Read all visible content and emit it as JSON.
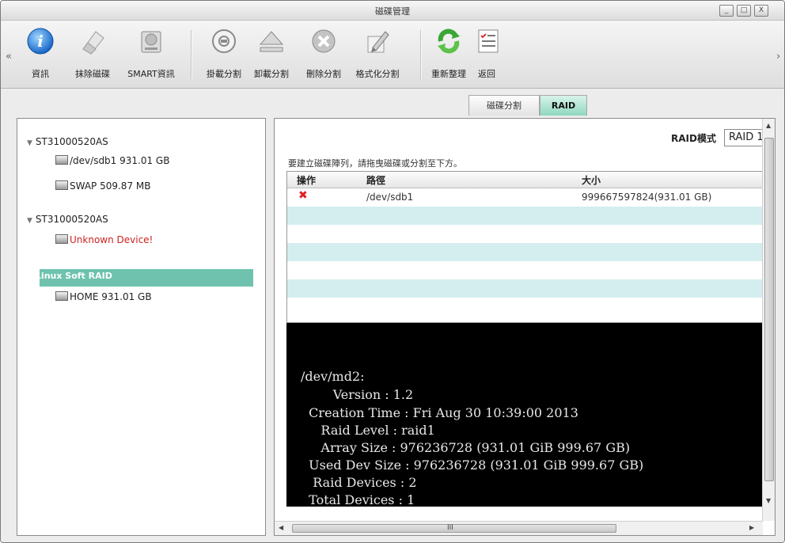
{
  "window": {
    "title": "磁碟管理",
    "controls": [
      "_",
      "□",
      "X"
    ]
  },
  "toolbar": {
    "left_arrow": "«",
    "right_arrow": "›",
    "buttons": [
      {
        "label": "資訊",
        "icon": "info-icon"
      },
      {
        "label": "抹除磁碟",
        "icon": "eraser-icon"
      },
      {
        "label": "SMART資訊",
        "icon": "smart-disk-icon"
      },
      {
        "label": "掛載分割",
        "icon": "mount-icon"
      },
      {
        "label": "卸載分割",
        "icon": "eject-icon"
      },
      {
        "label": "刪除分割",
        "icon": "delete-icon"
      },
      {
        "label": "格式化分割",
        "icon": "format-pencil-icon"
      },
      {
        "label": "重新整理",
        "icon": "refresh-icon"
      },
      {
        "label": "返回",
        "icon": "checklist-icon"
      }
    ]
  },
  "tabs": [
    {
      "label": "磁碟分割",
      "active": false
    },
    {
      "label": "RAID",
      "active": true
    }
  ],
  "tree": {
    "groups": [
      {
        "name": "ST31000520AS",
        "items": [
          {
            "label": "/dev/sdb1 931.01 GB",
            "color": "#222222"
          },
          {
            "label": "SWAP 509.87 MB",
            "color": "#222222"
          }
        ]
      },
      {
        "name": "ST31000520AS",
        "items": [
          {
            "label": "Unknown Device!",
            "color": "#cc2222"
          }
        ]
      },
      {
        "name": "Linux Soft RAID",
        "selected": true,
        "items": [
          {
            "label": "HOME 931.01 GB",
            "color": "#222222"
          }
        ]
      }
    ]
  },
  "raid": {
    "mode_label": "RAID模式",
    "mode_value": "RAID 1",
    "instruction": "要建立磁碟陣列，請拖曳磁碟或分割至下方。",
    "columns": [
      "操作",
      "路徑",
      "大小"
    ],
    "rows": [
      {
        "action": "✖",
        "path": "/dev/sdb1",
        "size": "999667597824(931.01 GB)"
      }
    ]
  },
  "console": {
    "lines": [
      "/dev/md2:",
      "        Version : 1.2",
      "  Creation Time : Fri Aug 30 10:39:00 2013",
      "     Raid Level : raid1",
      "     Array Size : 976236728 (931.01 GiB 999.67 GB)",
      "  Used Dev Size : 976236728 (931.01 GiB 999.67 GB)",
      "   Raid Devices : 2",
      "  Total Devices : 1"
    ]
  },
  "scrollbar": {
    "hgrip": "III"
  },
  "colors": {
    "accent": "#6ec2ae",
    "tab_active": "#8fd8c0",
    "row_alt": "#d4eef0",
    "error": "#cc2222"
  }
}
